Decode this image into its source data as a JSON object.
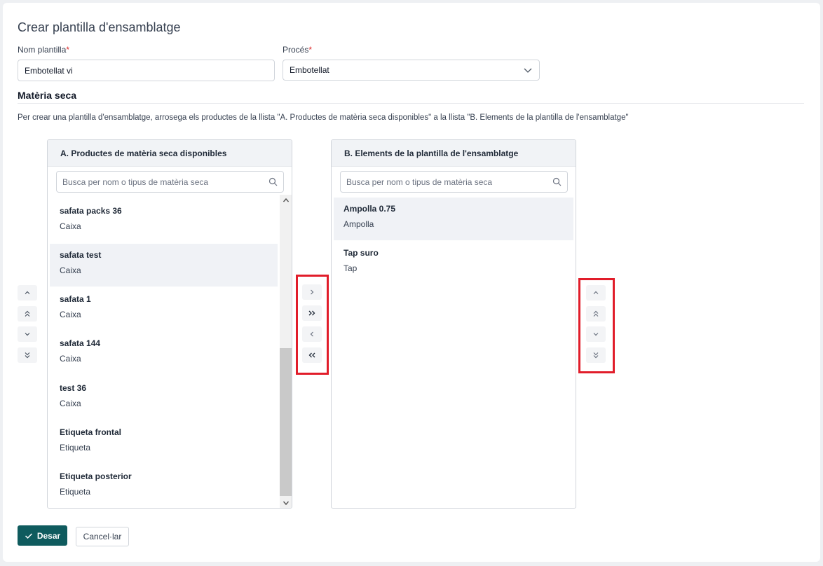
{
  "form": {
    "title": "Crear plantilla d'ensamblatge",
    "name_label": "Nom plantilla",
    "name_value": "Embotellat vi",
    "process_label": "Procés",
    "process_value": "Embotellat",
    "required_marker": "*"
  },
  "section": {
    "title": "Matèria seca",
    "instructions": "Per crear una plantilla d'ensamblatge, arrosega els productes de la llista \"A. Productes de matèria seca disponibles\" a la llista \"B. Elements de la plantilla de l'ensamblatge\""
  },
  "list_a": {
    "header": "A. Productes de matèria seca disponibles",
    "search_placeholder": "Busca per nom o tipus de matèria seca",
    "items": [
      {
        "name": "safata packs 36",
        "type": "Caixa"
      },
      {
        "name": "safata test",
        "type": "Caixa"
      },
      {
        "name": "safata 1",
        "type": "Caixa"
      },
      {
        "name": "safata 144",
        "type": "Caixa"
      },
      {
        "name": "test 36",
        "type": "Caixa"
      },
      {
        "name": "Etiqueta frontal",
        "type": "Etiqueta"
      },
      {
        "name": "Etiqueta posterior",
        "type": "Etiqueta"
      }
    ],
    "selected_index": 1
  },
  "list_b": {
    "header": "B. Elements de la plantilla de l'ensamblatge",
    "search_placeholder": "Busca per nom o tipus de matèria seca",
    "items": [
      {
        "name": "Ampolla 0.75",
        "type": "Ampolla"
      },
      {
        "name": "Tap suro",
        "type": "Tap"
      }
    ],
    "selected_index": 0
  },
  "transfer_icons": [
    "chevron-right",
    "double-chevron-right",
    "chevron-left",
    "double-chevron-left"
  ],
  "order_icons": [
    "chevron-up",
    "double-chevron-up",
    "chevron-down",
    "double-chevron-down"
  ],
  "actions": {
    "save_label": "Desar",
    "cancel_label": "Cancel·lar"
  },
  "colors": {
    "primary": "#0f5b5e",
    "required": "#dc2626",
    "highlight": "#e11d2a",
    "selected_row": "#f0f2f6"
  }
}
